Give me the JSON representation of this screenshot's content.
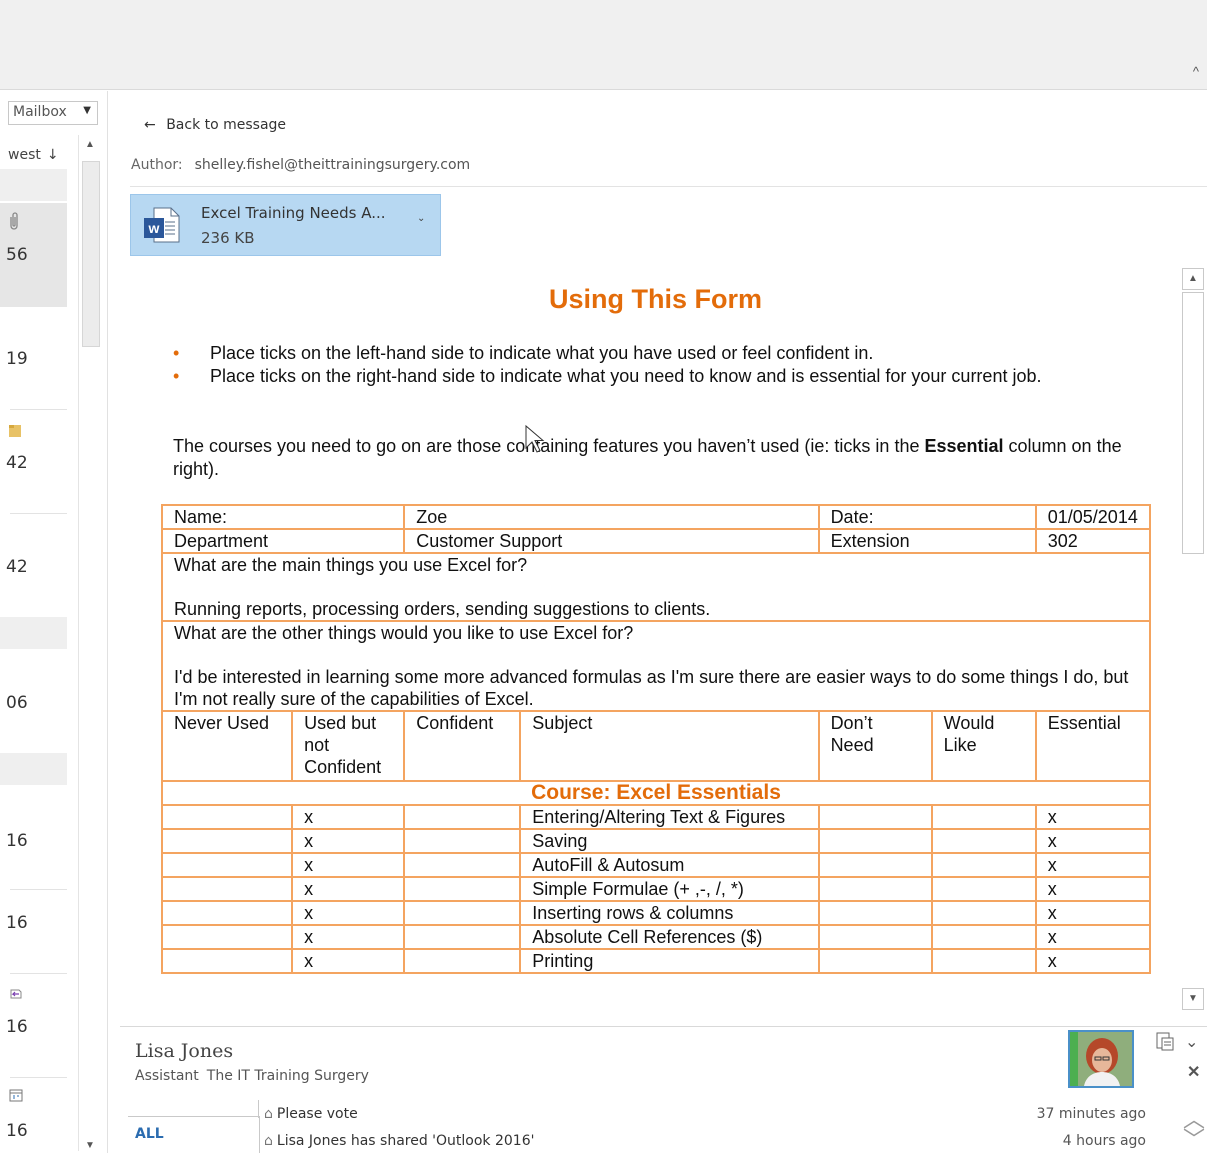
{
  "left_pane": {
    "mailbox_label": "Mailbox",
    "sort_label": "west",
    "sort_arrow": "↓",
    "items": [
      {
        "value": "56",
        "icon": "paperclip-icon"
      },
      {
        "value": "19",
        "icon": ""
      },
      {
        "value": "42",
        "icon": "folder-icon"
      },
      {
        "value": "42",
        "icon": ""
      },
      {
        "value": "06",
        "icon": ""
      },
      {
        "value": "16",
        "icon": ""
      },
      {
        "value": "16",
        "icon": ""
      },
      {
        "value": "16",
        "icon": "reply-icon"
      },
      {
        "value": "16",
        "icon": "calendar-icon"
      }
    ]
  },
  "reading": {
    "back_label": "Back to message",
    "author_label": "Author:",
    "author_email": "shelley.fishel@theittrainingsurgery.com",
    "attachment": {
      "name": "Excel Training Needs A...",
      "size": "236 KB",
      "icon": "word-document-icon"
    }
  },
  "document": {
    "title": "Using This Form",
    "bullets": [
      "Place ticks on the left-hand side to indicate what you have used or feel confident in.",
      "Place ticks on the right-hand side to indicate what you need to know and is essential for your current job."
    ],
    "para_before": "The courses you need to go on are those containing features you haven’t used (ie: ticks in the ",
    "para_bold": "Essential",
    "para_after": " column on the right).",
    "form": {
      "name_label": "Name:",
      "name_value": "Zoe",
      "date_label": "Date:",
      "date_value": "01/05/2014",
      "dept_label": "Department",
      "dept_value": "Customer Support",
      "ext_label": "Extension",
      "ext_value": "302",
      "q1": "What are the main things you use Excel for?",
      "a1": "Running reports, processing orders, sending suggestions to clients.",
      "q2": "What are the other things would you like to use Excel for?",
      "a2": "I'd be interested in learning some more advanced formulas as I'm sure there are easier ways to do some things I do, but I'm not really sure of the capabilities of Excel.",
      "headers": [
        "Never Used",
        "Used but not Confident",
        "Confident",
        "Subject",
        "Don’t Need",
        "Would Like",
        "Essential"
      ],
      "course_title": "Course: Excel Essentials",
      "rows": [
        {
          "never": "",
          "used": "x",
          "confident": "",
          "subject": "Entering/Altering Text & Figures",
          "dont": "",
          "would": "",
          "essential": "x"
        },
        {
          "never": "",
          "used": "x",
          "confident": "",
          "subject": "Saving",
          "dont": "",
          "would": "",
          "essential": "x"
        },
        {
          "never": "",
          "used": "x",
          "confident": "",
          "subject": "AutoFill & Autosum",
          "dont": "",
          "would": "",
          "essential": "x"
        },
        {
          "never": "",
          "used": "x",
          "confident": "",
          "subject": "Simple Formulae (+ ,-, /, *)",
          "dont": "",
          "would": "",
          "essential": "x"
        },
        {
          "never": "",
          "used": "x",
          "confident": "",
          "subject": "Inserting rows & columns",
          "dont": "",
          "would": "",
          "essential": "x"
        },
        {
          "never": "",
          "used": "x",
          "confident": "",
          "subject": "Absolute Cell References ($)",
          "dont": "",
          "would": "",
          "essential": "x"
        },
        {
          "never": "",
          "used": "x",
          "confident": "",
          "subject": "Printing",
          "dont": "",
          "would": "",
          "essential": "x"
        }
      ]
    }
  },
  "people_pane": {
    "name": "Lisa Jones",
    "title": "Assistant",
    "company": "The IT Training Surgery",
    "tab_all": "ALL",
    "feed": [
      {
        "text": "Please vote",
        "time": "37 minutes ago"
      },
      {
        "text": "Lisa Jones has shared 'Outlook 2016'",
        "time": "4 hours ago"
      }
    ]
  },
  "colors": {
    "accent_orange": "#e36c0a",
    "table_border": "#f4a460",
    "attachment_bg": "#b7d8f2",
    "link_blue": "#2b6cb0"
  }
}
